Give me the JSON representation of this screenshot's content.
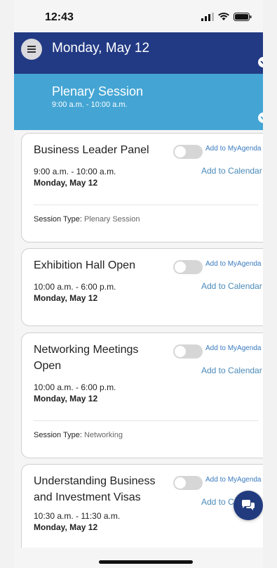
{
  "status": {
    "time": "12:43"
  },
  "header": {
    "day_title": "Monday, May 12"
  },
  "session": {
    "title": "Plenary Session",
    "time": "9:00 a.m. - 10:00 a.m."
  },
  "labels": {
    "add_myagenda": "Add to MyAgenda",
    "add_calendar": "Add to Calendar",
    "session_type": "Session Type:",
    "add_calendar_partial": "Add to C"
  },
  "cards": [
    {
      "title": "Business Leader Panel",
      "time": "9:00 a.m. - 10:00 a.m.",
      "day": "Monday, May 12",
      "session_type": "Plenary Session",
      "agenda_added": false
    },
    {
      "title": "Exhibition Hall Open",
      "time": "10:00 a.m. - 6:00 p.m.",
      "day": "Monday, May 12",
      "session_type": "",
      "agenda_added": false
    },
    {
      "title": "Networking Meetings Open",
      "time": "10:00 a.m. - 6:00 p.m.",
      "day": "Monday, May 12",
      "session_type": "Networking",
      "agenda_added": false
    },
    {
      "title": "Understanding Business and Investment Visas",
      "time": "10:30 a.m. - 11:30 a.m.",
      "day": "Monday, May 12",
      "session_type": "",
      "agenda_added": false
    }
  ],
  "colors": {
    "header": "#223a84",
    "session_bar": "#44a5d4",
    "link": "#4a8ab8",
    "fab": "#213b7e"
  },
  "icons": {
    "menu": "hamburger-icon",
    "chevron": "chevron-down-icon",
    "chat": "chat-icon"
  }
}
